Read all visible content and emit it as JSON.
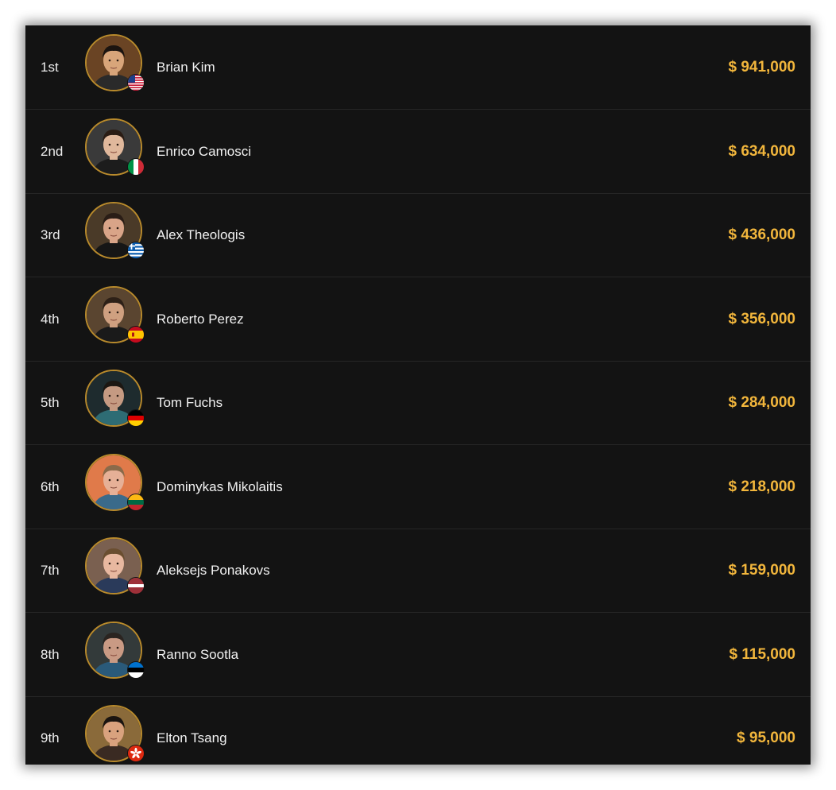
{
  "results": [
    {
      "rank": "1st",
      "name": "Brian Kim",
      "prize": "$ 941,000",
      "country": "USA",
      "flag": "flag-us",
      "avatar": {
        "bg": "#6a4424",
        "skin": "#d8a57a",
        "hair": "#1b1410",
        "shirt": "#2a2a2a"
      }
    },
    {
      "rank": "2nd",
      "name": "Enrico Camosci",
      "prize": "$ 634,000",
      "country": "Italy",
      "flag": "flag-it",
      "avatar": {
        "bg": "#3a3a3a",
        "skin": "#e0b89c",
        "hair": "#2a1c14",
        "shirt": "#1c1c1c"
      }
    },
    {
      "rank": "3rd",
      "name": "Alex Theologis",
      "prize": "$ 436,000",
      "country": "Greece",
      "flag": "flag-gr",
      "avatar": {
        "bg": "#4a3a28",
        "skin": "#d9a488",
        "hair": "#2a1d16",
        "shirt": "#161616"
      }
    },
    {
      "rank": "4th",
      "name": "Roberto Perez",
      "prize": "$ 356,000",
      "country": "Spain",
      "flag": "flag-es",
      "avatar": {
        "bg": "#5a4530",
        "skin": "#cfa080",
        "hair": "#2d2017",
        "shirt": "#1a1a1a"
      }
    },
    {
      "rank": "5th",
      "name": "Tom Fuchs",
      "prize": "$ 284,000",
      "country": "Germany",
      "flag": "flag-de",
      "avatar": {
        "bg": "#1e2b2e",
        "skin": "#c59a82",
        "hair": "#1c1712",
        "shirt": "#2e6c74"
      }
    },
    {
      "rank": "6th",
      "name": "Dominykas Mikolaitis",
      "prize": "$ 218,000",
      "country": "Lithuania",
      "flag": "flag-lt",
      "avatar": {
        "bg": "#e07a4a",
        "skin": "#e6b097",
        "hair": "#8a6a4a",
        "shirt": "#3a6a8a"
      }
    },
    {
      "rank": "7th",
      "name": "Aleksejs Ponakovs",
      "prize": "$ 159,000",
      "country": "Latvia",
      "flag": "flag-lv",
      "avatar": {
        "bg": "#7a6050",
        "skin": "#e8b8a0",
        "hair": "#6a4e30",
        "shirt": "#2a3a5a"
      }
    },
    {
      "rank": "8th",
      "name": "Ranno Sootla",
      "prize": "$ 115,000",
      "country": "Estonia",
      "flag": "flag-ee",
      "avatar": {
        "bg": "#333a3a",
        "skin": "#c99a84",
        "hair": "#2a2420",
        "shirt": "#2a5a7a"
      }
    },
    {
      "rank": "9th",
      "name": "Elton Tsang",
      "prize": "$ 95,000",
      "country": "Hong Kong",
      "flag": "flag-hk",
      "avatar": {
        "bg": "#8a6a3a",
        "skin": "#d9a27e",
        "hair": "#1a1410",
        "shirt": "#3a2a22"
      }
    }
  ]
}
